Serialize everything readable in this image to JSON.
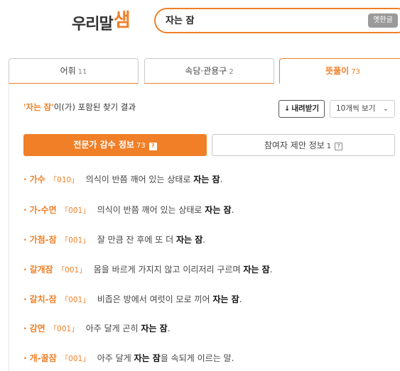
{
  "header": {
    "logo_main": "우리말",
    "logo_accent": "샘",
    "search_value": "자는 잠",
    "ime_label": "옛한글"
  },
  "tabs": [
    {
      "label": "어휘",
      "count": "11"
    },
    {
      "label": "속담·관용구",
      "count": "2"
    },
    {
      "label": "뜻풀이",
      "count": "73"
    }
  ],
  "result": {
    "keyword": "'자는 잠'",
    "suffix": "이(가) 포함된 찾기 결과",
    "download_label": "내려받기",
    "page_size": "10개씩 보기"
  },
  "subtabs": {
    "expert_label": "전문가 감수 정보",
    "expert_count": "73",
    "user_label": "참여자 제안 정보",
    "user_count": "1",
    "help_glyph": "?"
  },
  "entries": [
    {
      "word": "가수",
      "src": "「010」",
      "pre": "의식이 반쯤 깨어 있는 상태로 ",
      "hl": "자는 잠",
      "post": "."
    },
    {
      "word": "가-수면",
      "src": "「001」",
      "pre": "의식이 반쯤 깨어 있는 상태로 ",
      "hl": "자는 잠",
      "post": "."
    },
    {
      "word": "가첨-잠",
      "src": "「001」",
      "pre": "잘 만큼 잔 후에 또 더 ",
      "hl": "자는 잠",
      "post": "."
    },
    {
      "word": "갈개잠",
      "src": "「001」",
      "pre": "몸을 바르게 가지지 않고 이리저리 구르며 ",
      "hl": "자는 잠",
      "post": "."
    },
    {
      "word": "갈치-잠",
      "src": "「001」",
      "pre": "비좁은 방에서 여럿이 모로 끼어 ",
      "hl": "자는 잠",
      "post": "."
    },
    {
      "word": "감면",
      "src": "「001」",
      "pre": "아주 달게 곤히 ",
      "hl": "자는 잠",
      "post": "."
    },
    {
      "word": "개-꿀잠",
      "src": "「001」",
      "pre": "아주 달게 ",
      "hl": "자는 잠",
      "post": "을 속되게 이르는 말."
    }
  ]
}
